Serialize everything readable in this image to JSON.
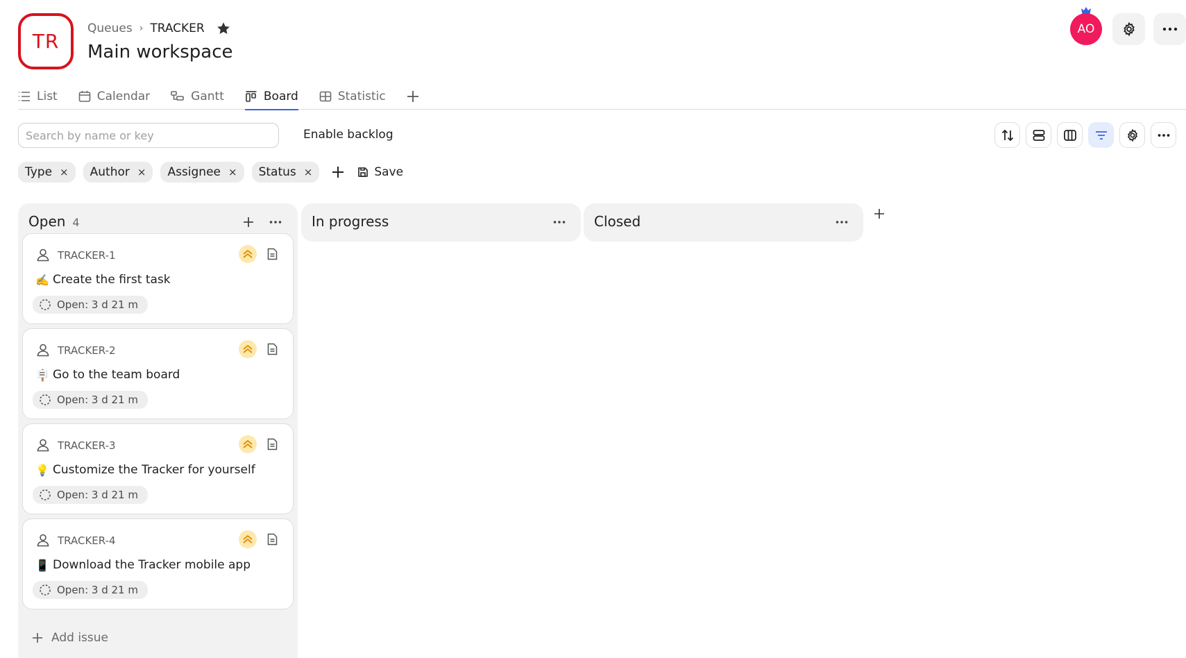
{
  "queue": {
    "logo_text": "TR"
  },
  "breadcrumb": {
    "parent": "Queues",
    "separator": "›",
    "current": "TRACKER"
  },
  "page_title": "Main workspace",
  "user": {
    "initials": "AO",
    "avatar_color": "#f01a5c"
  },
  "tabs": [
    {
      "label": "List",
      "icon": "list-icon"
    },
    {
      "label": "Calendar",
      "icon": "calendar-icon"
    },
    {
      "label": "Gantt",
      "icon": "gantt-icon"
    },
    {
      "label": "Board",
      "icon": "board-icon",
      "active": true
    },
    {
      "label": "Statistic",
      "icon": "table-icon"
    }
  ],
  "search": {
    "placeholder": "Search by name or key",
    "value": ""
  },
  "backlog_label": "Enable backlog",
  "filters": [
    {
      "label": "Type",
      "remove": "×"
    },
    {
      "label": "Author",
      "remove": "×"
    },
    {
      "label": "Assignee",
      "remove": "×"
    },
    {
      "label": "Status",
      "remove": "×"
    }
  ],
  "save_label": "Save",
  "columns": [
    {
      "title": "Open",
      "count": "4",
      "cards": [
        {
          "key": "TRACKER-1",
          "emoji": "✍️",
          "title": "Create the first task",
          "status": "Open: 3 d 21 m"
        },
        {
          "key": "TRACKER-2",
          "emoji": "🪧",
          "title": "Go to the team board",
          "status": "Open: 3 d 21 m"
        },
        {
          "key": "TRACKER-3",
          "emoji": "💡",
          "title": "Customize the Tracker for yourself",
          "status": "Open: 3 d 21 m"
        },
        {
          "key": "TRACKER-4",
          "emoji": "📱",
          "title": "Download the Tracker mobile app",
          "status": "Open: 3 d 21 m"
        }
      ],
      "add_issue_label": "Add issue"
    },
    {
      "title": "In progress"
    },
    {
      "title": "Closed"
    }
  ],
  "colors": {
    "accent": "#3a63e0",
    "logo_red": "#d6141d",
    "priority_bg": "#fde9ae",
    "priority_fg": "#e08a00"
  }
}
